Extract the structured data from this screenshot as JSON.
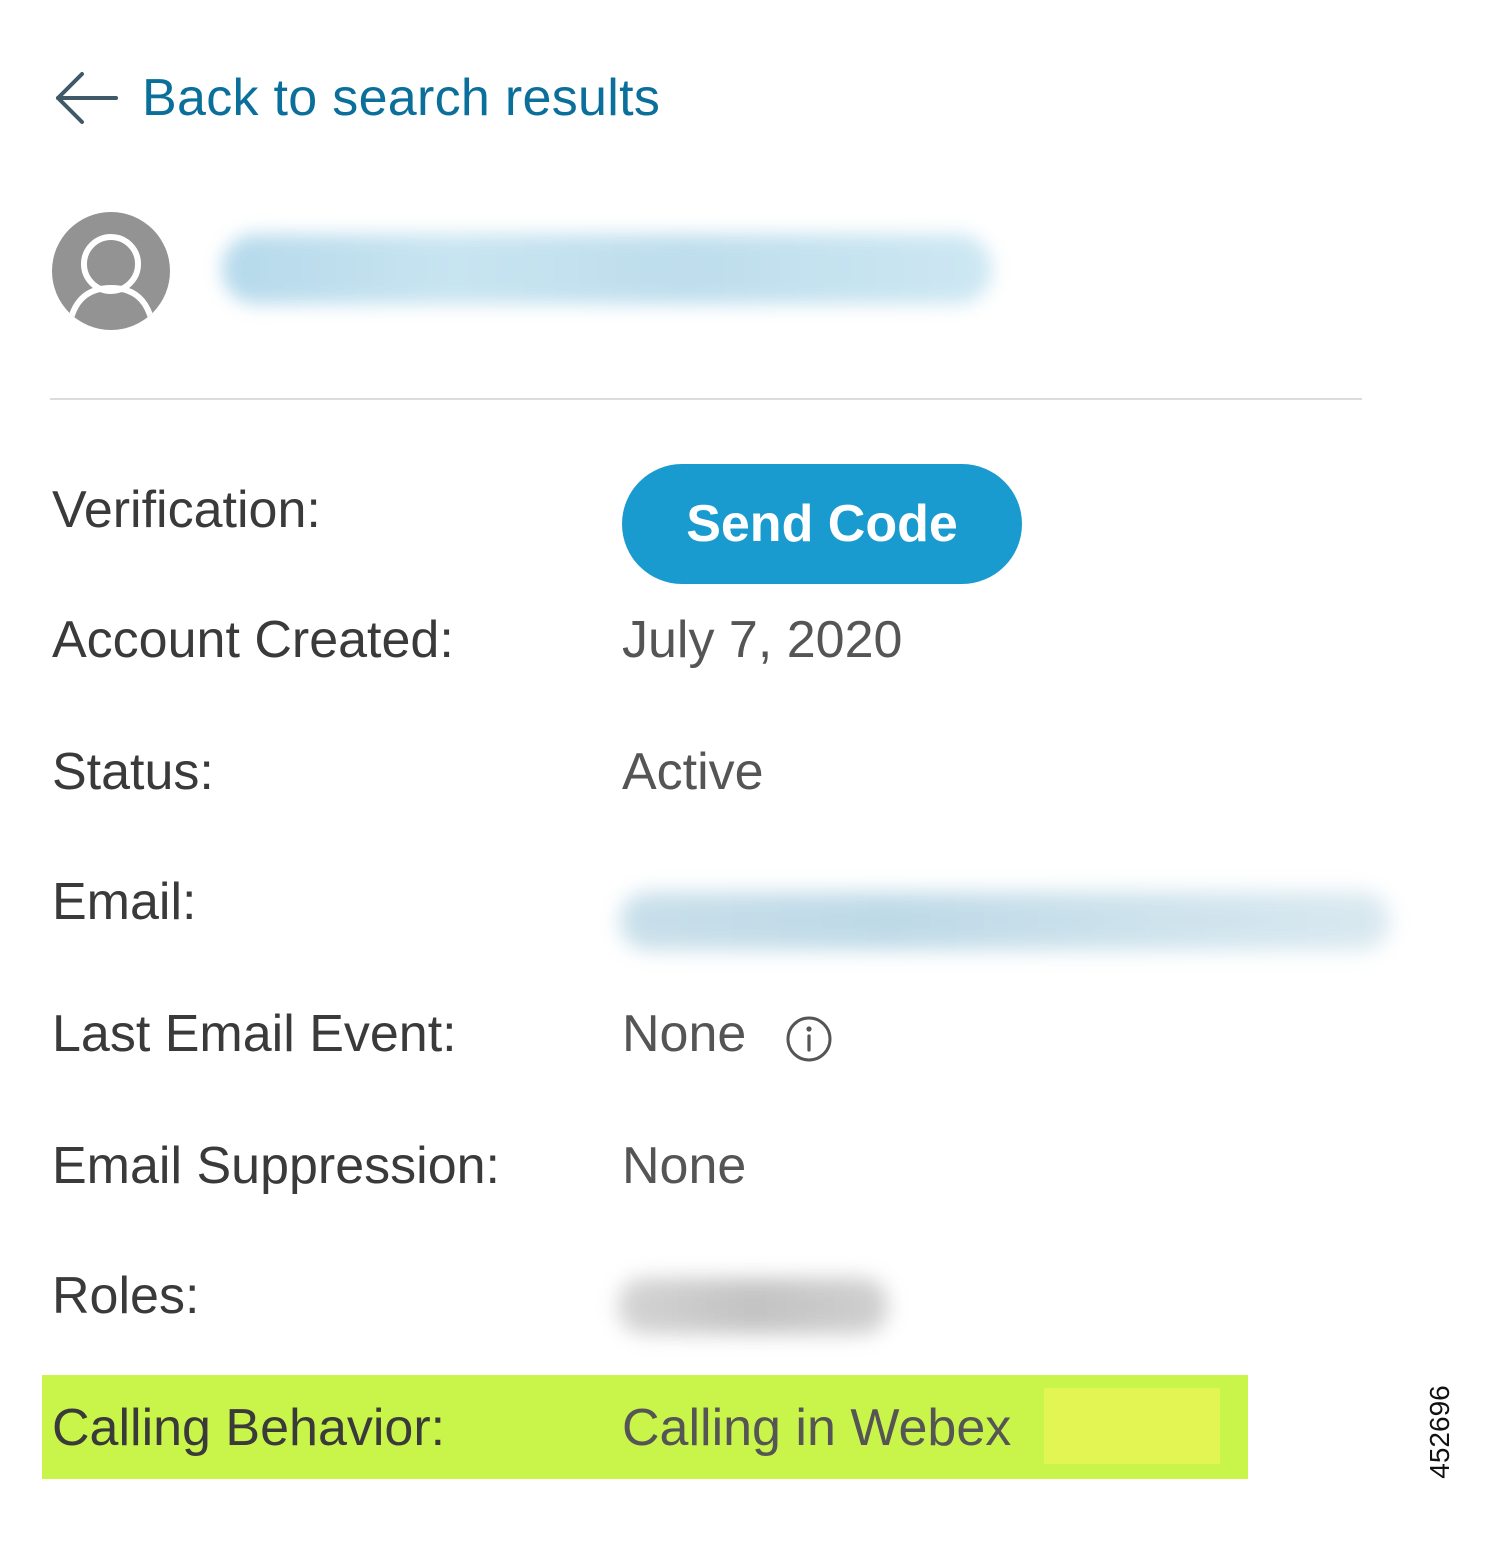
{
  "back_link": {
    "label": "Back to search results"
  },
  "user": {
    "name": "",
    "avatar_color": "#939393"
  },
  "fields": {
    "verification": {
      "label": "Verification:",
      "button_label": "Send Code"
    },
    "account_created": {
      "label": "Account Created:",
      "value": "July 7, 2020"
    },
    "status": {
      "label": "Status:",
      "value": "Active"
    },
    "email": {
      "label": "Email:",
      "value": ""
    },
    "last_email_event": {
      "label": "Last Email Event:",
      "value": "None",
      "icon": "info-icon"
    },
    "email_suppression": {
      "label": "Email Suppression:",
      "value": "None"
    },
    "roles": {
      "label": "Roles:",
      "value": ""
    },
    "calling_behavior": {
      "label": "Calling Behavior:",
      "value": "Calling in Webex",
      "highlight_color": "#c9f54a"
    }
  },
  "colors": {
    "link": "#0b6f9c",
    "button": "#1a9bd0"
  },
  "figure_id": "452696"
}
